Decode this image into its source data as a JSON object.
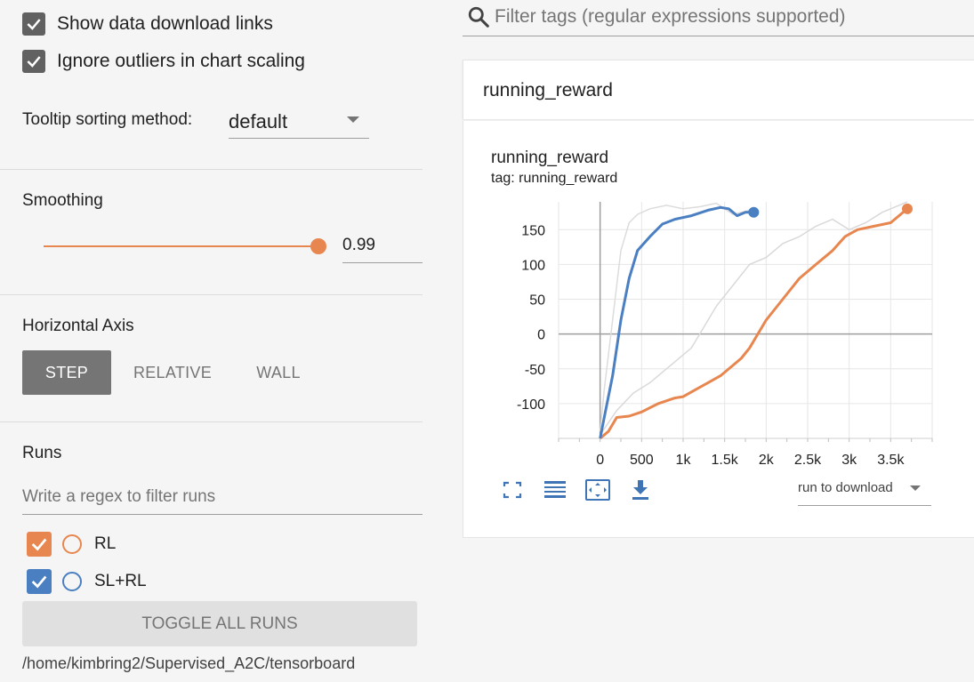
{
  "sidebar": {
    "show_download_links": {
      "label": "Show data download links",
      "checked": true
    },
    "ignore_outliers": {
      "label": "Ignore outliers in chart scaling",
      "checked": true
    },
    "tooltip_sorting": {
      "label": "Tooltip sorting method:",
      "value": "default"
    },
    "smoothing": {
      "title": "Smoothing",
      "value": "0.99",
      "fraction": 0.99
    },
    "horizontal_axis": {
      "title": "Horizontal Axis",
      "options": [
        "STEP",
        "RELATIVE",
        "WALL"
      ],
      "selected": "STEP"
    },
    "runs": {
      "title": "Runs",
      "filter_placeholder": "Write a regex to filter runs",
      "items": [
        {
          "name": "RL",
          "checked": true,
          "color": "#e8864f"
        },
        {
          "name": "SL+RL",
          "checked": true,
          "color": "#4a7fc1"
        }
      ],
      "toggle_label": "TOGGLE ALL RUNS",
      "logdir": "/home/kimbring2/Supervised_A2C/tensorboard"
    }
  },
  "main": {
    "filter_placeholder": "Filter tags (regular expressions supported)",
    "card_title": "running_reward",
    "chart": {
      "title": "running_reward",
      "subtitle": "tag: running_reward",
      "download_placeholder": "run to download"
    }
  },
  "chart_data": {
    "type": "line",
    "title": "running_reward",
    "subtitle": "tag: running_reward",
    "xlabel": "",
    "ylabel": "",
    "xlim": [
      -500,
      4000
    ],
    "ylim": [
      -150,
      190
    ],
    "x_ticks": [
      0,
      500,
      1000,
      1500,
      2000,
      2500,
      3000,
      3500
    ],
    "x_tick_labels": [
      "0",
      "500",
      "1k",
      "1.5k",
      "2k",
      "2.5k",
      "3k",
      "3.5k"
    ],
    "y_ticks": [
      -100,
      -50,
      0,
      50,
      100,
      150
    ],
    "y_tick_labels": [
      "-100",
      "-50",
      "0",
      "50",
      "100",
      "150"
    ],
    "grid": true,
    "series": [
      {
        "name": "RL",
        "color": "#e8864f",
        "raw_color": "#d9d9d9",
        "smoothed": [
          [
            0,
            -150
          ],
          [
            100,
            -140
          ],
          [
            200,
            -120
          ],
          [
            350,
            -118
          ],
          [
            500,
            -112
          ],
          [
            700,
            -100
          ],
          [
            900,
            -92
          ],
          [
            1000,
            -90
          ],
          [
            1150,
            -80
          ],
          [
            1300,
            -70
          ],
          [
            1450,
            -60
          ],
          [
            1600,
            -45
          ],
          [
            1700,
            -35
          ],
          [
            1800,
            -20
          ],
          [
            1900,
            0
          ],
          [
            2000,
            20
          ],
          [
            2200,
            50
          ],
          [
            2400,
            80
          ],
          [
            2600,
            100
          ],
          [
            2800,
            120
          ],
          [
            2950,
            140
          ],
          [
            3100,
            150
          ],
          [
            3300,
            155
          ],
          [
            3500,
            160
          ],
          [
            3600,
            170
          ],
          [
            3700,
            180
          ]
        ],
        "raw": [
          [
            0,
            -145
          ],
          [
            200,
            -110
          ],
          [
            400,
            -85
          ],
          [
            600,
            -70
          ],
          [
            700,
            -60
          ],
          [
            900,
            -40
          ],
          [
            1100,
            -20
          ],
          [
            1200,
            0
          ],
          [
            1400,
            40
          ],
          [
            1600,
            70
          ],
          [
            1800,
            100
          ],
          [
            2000,
            110
          ],
          [
            2200,
            130
          ],
          [
            2400,
            140
          ],
          [
            2600,
            155
          ],
          [
            2800,
            165
          ],
          [
            3000,
            150
          ],
          [
            3200,
            160
          ],
          [
            3400,
            175
          ],
          [
            3600,
            185
          ],
          [
            3700,
            190
          ]
        ],
        "end_marker": [
          3700,
          180
        ]
      },
      {
        "name": "SL+RL",
        "color": "#4a7fc1",
        "raw_color": "#dcdcdc",
        "smoothed": [
          [
            0,
            -150
          ],
          [
            50,
            -120
          ],
          [
            150,
            -60
          ],
          [
            250,
            20
          ],
          [
            350,
            80
          ],
          [
            450,
            120
          ],
          [
            600,
            140
          ],
          [
            750,
            158
          ],
          [
            900,
            165
          ],
          [
            1100,
            170
          ],
          [
            1300,
            178
          ],
          [
            1450,
            182
          ],
          [
            1550,
            180
          ],
          [
            1650,
            170
          ],
          [
            1750,
            175
          ],
          [
            1850,
            175
          ]
        ],
        "raw": [
          [
            0,
            -140
          ],
          [
            50,
            -80
          ],
          [
            150,
            20
          ],
          [
            250,
            120
          ],
          [
            350,
            160
          ],
          [
            450,
            172
          ],
          [
            600,
            180
          ],
          [
            800,
            185
          ],
          [
            1000,
            180
          ],
          [
            1200,
            183
          ],
          [
            1400,
            188
          ],
          [
            1600,
            172
          ],
          [
            1800,
            178
          ],
          [
            1850,
            176
          ]
        ],
        "end_marker": [
          1850,
          175
        ]
      }
    ]
  }
}
